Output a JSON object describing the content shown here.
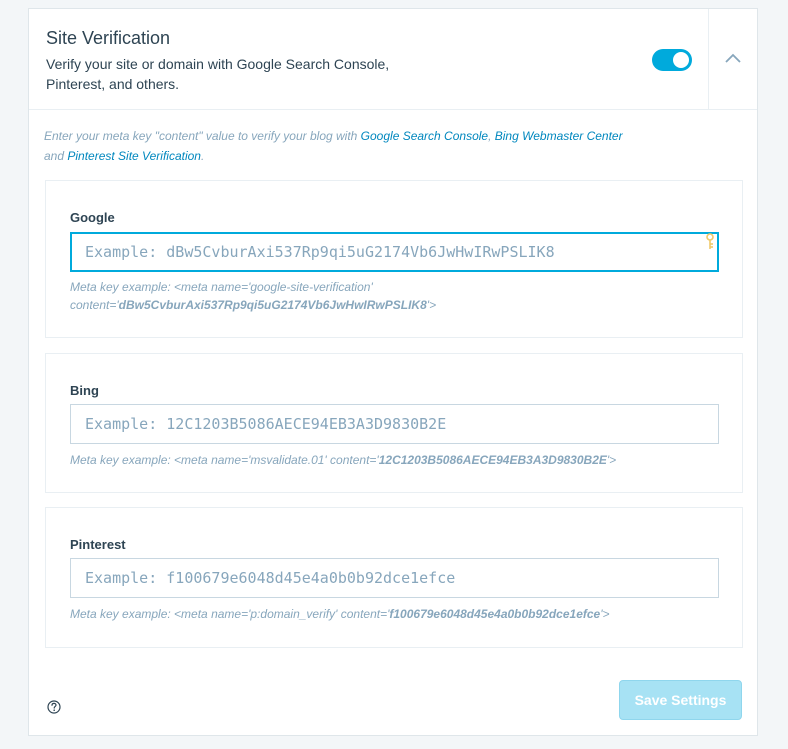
{
  "header": {
    "title": "Site Verification",
    "description": "Verify your site or domain with Google Search Console, Pinterest, and others.",
    "toggle_on": true
  },
  "intro": {
    "prefix": "Enter your meta key \"content\" value to verify your blog with ",
    "link_google": "Google Search Console",
    "sep1": ", ",
    "link_bing": "Bing Webmaster Center",
    "sep2": " and ",
    "link_pinterest": "Pinterest Site Verification",
    "suffix": "."
  },
  "google": {
    "label": "Google",
    "placeholder": "Example: dBw5CvburAxi537Rp9qi5uG2174Vb6JwHwIRwPSLIK8",
    "value": "",
    "hint_prefix": "Meta key example: <meta name='google-site-verification' content='",
    "hint_key": "dBw5CvburAxi537Rp9qi5uG2174Vb6JwHwIRwPSLIK8",
    "hint_suffix": "'>"
  },
  "bing": {
    "label": "Bing",
    "placeholder": "Example: 12C1203B5086AECE94EB3A3D9830B2E",
    "value": "",
    "hint_prefix": "Meta key example: <meta name='msvalidate.01' content='",
    "hint_key": "12C1203B5086AECE94EB3A3D9830B2E",
    "hint_suffix": "'>"
  },
  "pinterest": {
    "label": "Pinterest",
    "placeholder": "Example: f100679e6048d45e4a0b0b92dce1efce",
    "value": "",
    "hint_prefix": "Meta key example: <meta name='p:domain_verify' content='",
    "hint_key": "f100679e6048d45e4a0b0b92dce1efce",
    "hint_suffix": "'>"
  },
  "footer": {
    "help_icon": "help-circle-icon",
    "save_label": "Save Settings"
  },
  "colors": {
    "accent": "#00aadc",
    "link": "#0087be",
    "muted": "#87a6bc",
    "text": "#2e4453",
    "save_disabled": "#a7e2f4"
  }
}
